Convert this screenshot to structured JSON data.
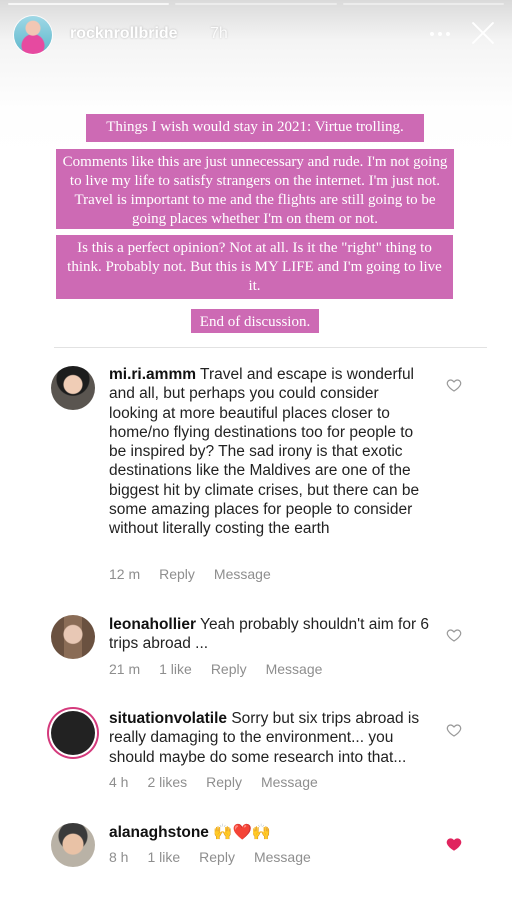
{
  "story": {
    "username": "rocknrollbride",
    "time": "7h"
  },
  "texts": [
    "Things I wish would stay in 2021: Virtue trolling.",
    "Comments like this are just unnecessary and rude. I'm not going to live my life to satisfy strangers on the internet. I'm just not. Travel is important to me and the flights are still going to be going places whether I'm on them or not.",
    "Is this a perfect opinion? Not at all. Is it the \"right\" thing to think. Probably not.  But this is MY LIFE and I'm going to live it.",
    "End of discussion."
  ],
  "comments": [
    {
      "user": "mi.ri.ammm",
      "text": "Travel and escape is wonderful and all, but perhaps you could consider looking at more beautiful places closer to home/no flying destinations too for people to be inspired by? The sad irony is that exotic destinations like the Maldives are one of the biggest hit by climate crises, but there can be some amazing places for people to consider without literally costing the earth",
      "time": "12 m",
      "reply": "Reply",
      "message": "Message"
    },
    {
      "user": "leonahollier",
      "text": "Yeah probably shouldn't aim for 6 trips abroad ...",
      "time": "21 m",
      "likes": "1 like",
      "reply": "Reply",
      "message": "Message"
    },
    {
      "user": "situationvolatile",
      "text": "Sorry but six trips abroad is really damaging to the environment... you should maybe do some research into that...",
      "time": "4 h",
      "likes": "2 likes",
      "reply": "Reply",
      "message": "Message"
    },
    {
      "user": "alanaghstone",
      "text": "🙌❤️🙌",
      "time": "8 h",
      "likes": "1 like",
      "reply": "Reply",
      "message": "Message",
      "liked": true
    }
  ],
  "colors": {
    "text_highlight": "#cd6ab4",
    "liked_heart": "#e0245e"
  }
}
